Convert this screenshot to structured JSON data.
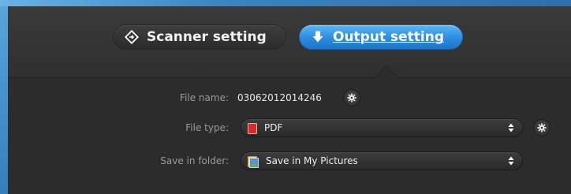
{
  "tabs": {
    "scanner": {
      "label": "Scanner setting",
      "icon": "diamond-arrow-icon"
    },
    "output": {
      "label": "Output setting",
      "icon": "download-arrow-icon",
      "active": true
    }
  },
  "form": {
    "file_name": {
      "label": "File name:",
      "value": "03062012014246",
      "icon": "gear-icon"
    },
    "file_type": {
      "label": "File type:",
      "value": "PDF",
      "icon": "pdf-icon",
      "settings_icon": "gear-icon"
    },
    "save_folder": {
      "label": "Save in folder:",
      "value": "Save in My Pictures",
      "icon": "pictures-folder-icon"
    }
  },
  "colors": {
    "accent": "#2f8fe0",
    "panel": "#2c2c2c",
    "pdf_red": "#d42b2b"
  }
}
